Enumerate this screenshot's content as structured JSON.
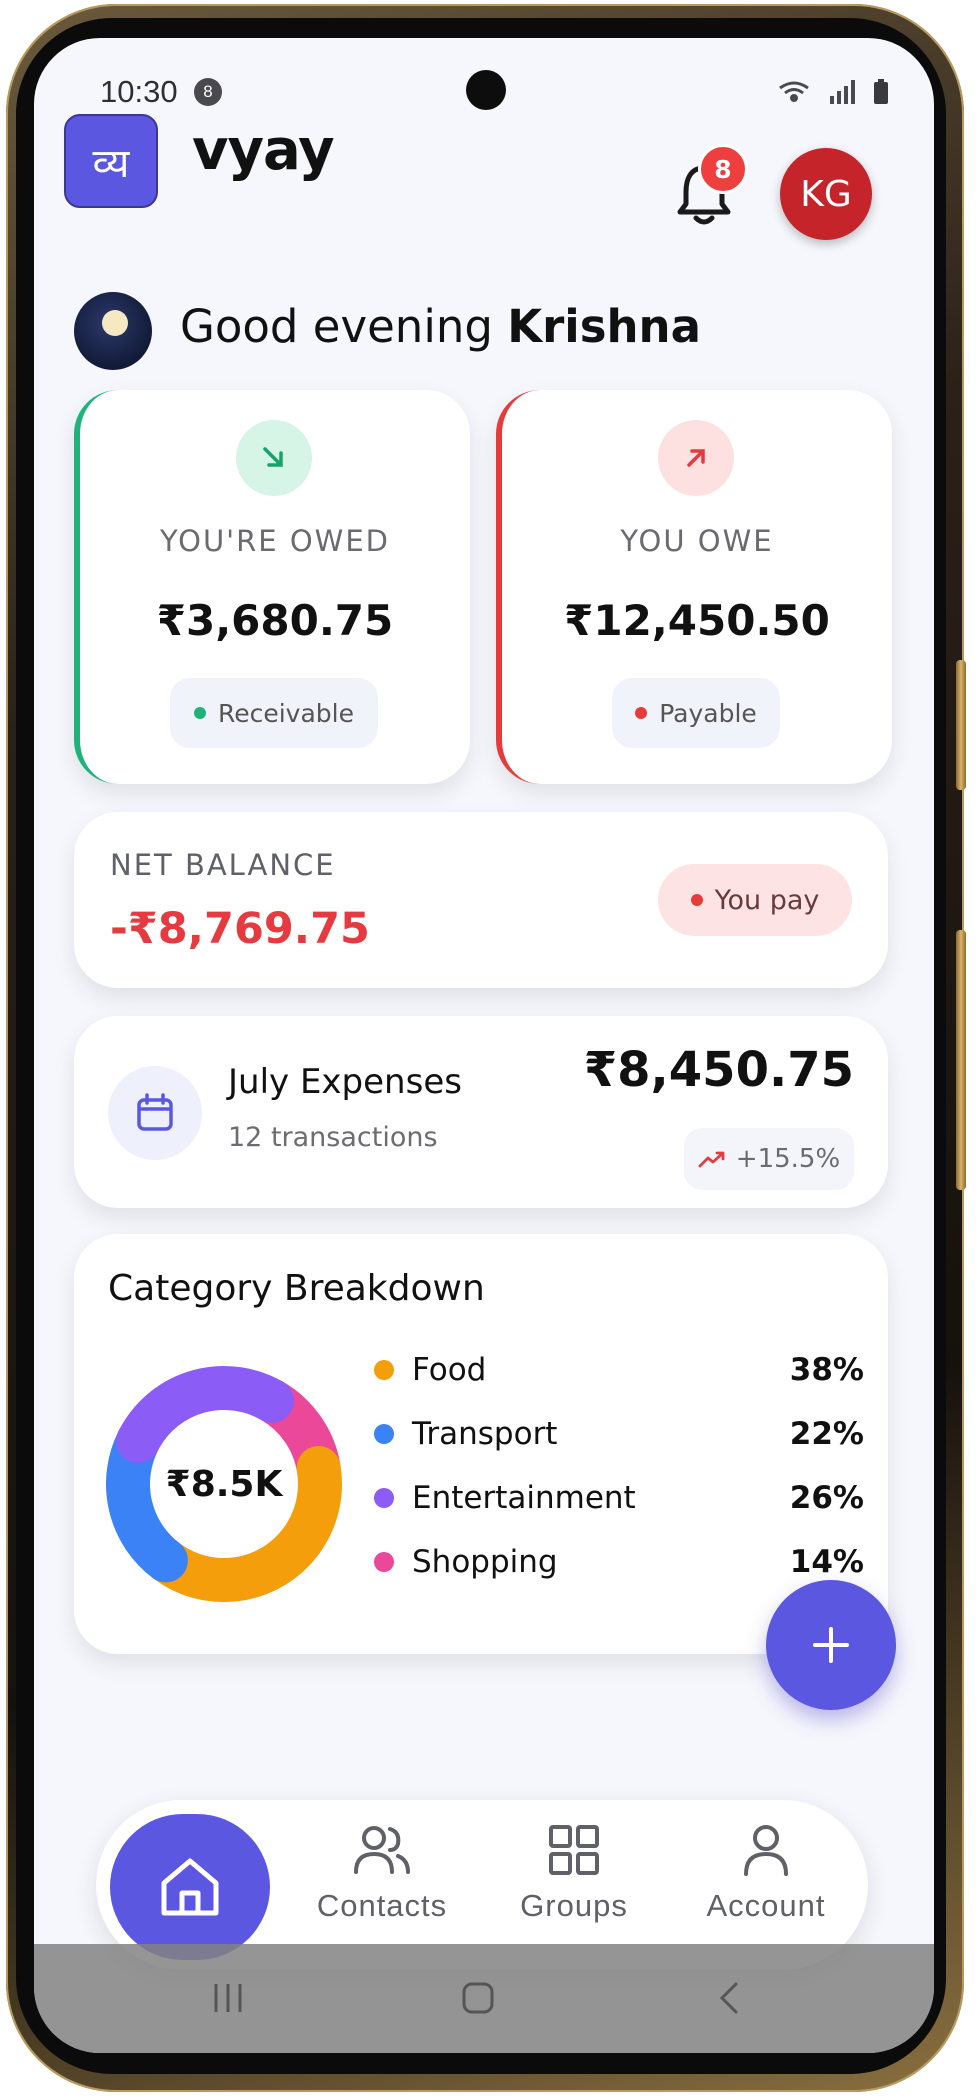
{
  "status_bar": {
    "time": "10:30",
    "notification_count": "8"
  },
  "header": {
    "logo_glyph": "व्य",
    "app_name": "vyay",
    "notification_badge": "8",
    "avatar_initials": "KG"
  },
  "greeting": {
    "prefix": "Good evening",
    "name": "Krishna"
  },
  "summary": {
    "owed": {
      "title": "YOU'RE OWED",
      "amount": "₹3,680.75",
      "pill": "Receivable",
      "color": "#1fb37a"
    },
    "owe": {
      "title": "YOU OWE",
      "amount": "₹12,450.50",
      "pill": "Payable",
      "color": "#e63b3b"
    }
  },
  "net_balance": {
    "title": "NET BALANCE",
    "amount": "-₹8,769.75",
    "status": "You pay"
  },
  "monthly": {
    "title": "July Expenses",
    "transactions": "12 transactions",
    "amount": "₹8,450.75",
    "trend": "+15.5%"
  },
  "category_breakdown": {
    "title": "Category Breakdown",
    "total": "₹8.5K",
    "categories": [
      {
        "name": "Food",
        "percent": "38%",
        "color": "#f59e0b"
      },
      {
        "name": "Transport",
        "percent": "22%",
        "color": "#3b82f6"
      },
      {
        "name": "Entertainment",
        "percent": "26%",
        "color": "#8b5cf6"
      },
      {
        "name": "Shopping",
        "percent": "14%",
        "color": "#ec4899"
      }
    ]
  },
  "nav": {
    "contacts": "Contacts",
    "groups": "Groups",
    "account": "Account"
  },
  "colors": {
    "brand": "#5b57e0",
    "negative": "#e53b40",
    "positive": "#1fb37a"
  }
}
